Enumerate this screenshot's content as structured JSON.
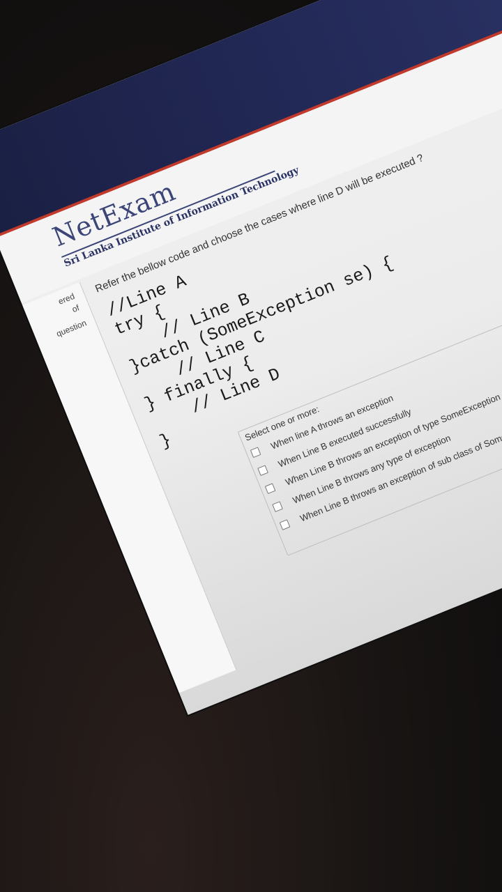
{
  "app": {
    "logo_text": "NetExam",
    "institute": "Sri Lanka Institute of Information Technology"
  },
  "nav": {
    "fragments": [
      "ered",
      "of",
      "question"
    ]
  },
  "question": {
    "text": "Refer the bellow code and choose the cases where  line D will be executed ?",
    "code_lines": [
      "//Line A",
      "try {",
      "    // Line B",
      "}catch (SomeException se) {",
      "    // Line C",
      "} finally {",
      "    // Line D",
      "",
      "}"
    ]
  },
  "answers": {
    "prompt": "Select one or more:",
    "options": [
      {
        "label": "When line A throws an exception",
        "checked": false
      },
      {
        "label": "When Line B executed successfully",
        "checked": false
      },
      {
        "label": "When Line B throws an exception of type SomeException",
        "checked": false
      },
      {
        "label": "When Line B throws any type of exception",
        "checked": false
      },
      {
        "label": "When Line B throws an exception of sub class of  SomeException",
        "checked": false
      }
    ]
  },
  "colors": {
    "header_navy": "#232a58",
    "accent_red": "#c23a2b",
    "logo_blue": "#3b4577"
  }
}
